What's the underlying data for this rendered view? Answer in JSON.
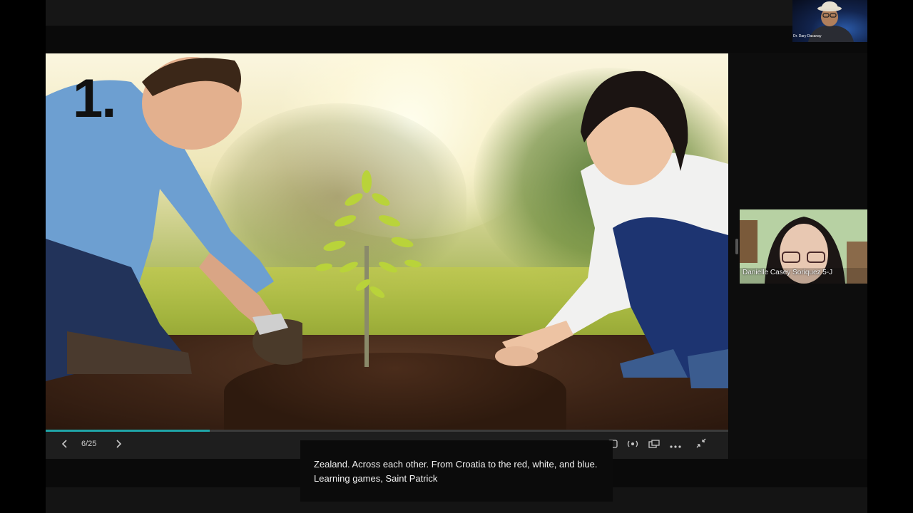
{
  "slide": {
    "number_label": "1."
  },
  "progress": {
    "fraction": 0.24
  },
  "controls": {
    "prev_icon": "chevron-left-icon",
    "next_icon": "chevron-right-icon",
    "page_counter": "6/25",
    "right_icons": [
      "captions-icon",
      "broadcast-icon",
      "screen-layout-icon",
      "more-icon",
      "exit-fullscreen-icon"
    ]
  },
  "caption": {
    "text": "Zealand. Across each other. From Croatia to the red, white, and blue. Learning games, Saint Patrick"
  },
  "participants": {
    "host_name": "Dr. Dary Dacanay",
    "participant_name": "Danielle Casey Soriquez 5-J"
  },
  "colors": {
    "progress_accent": "#1fa5a8",
    "control_bar": "#1e1e1e",
    "background": "#000000"
  }
}
